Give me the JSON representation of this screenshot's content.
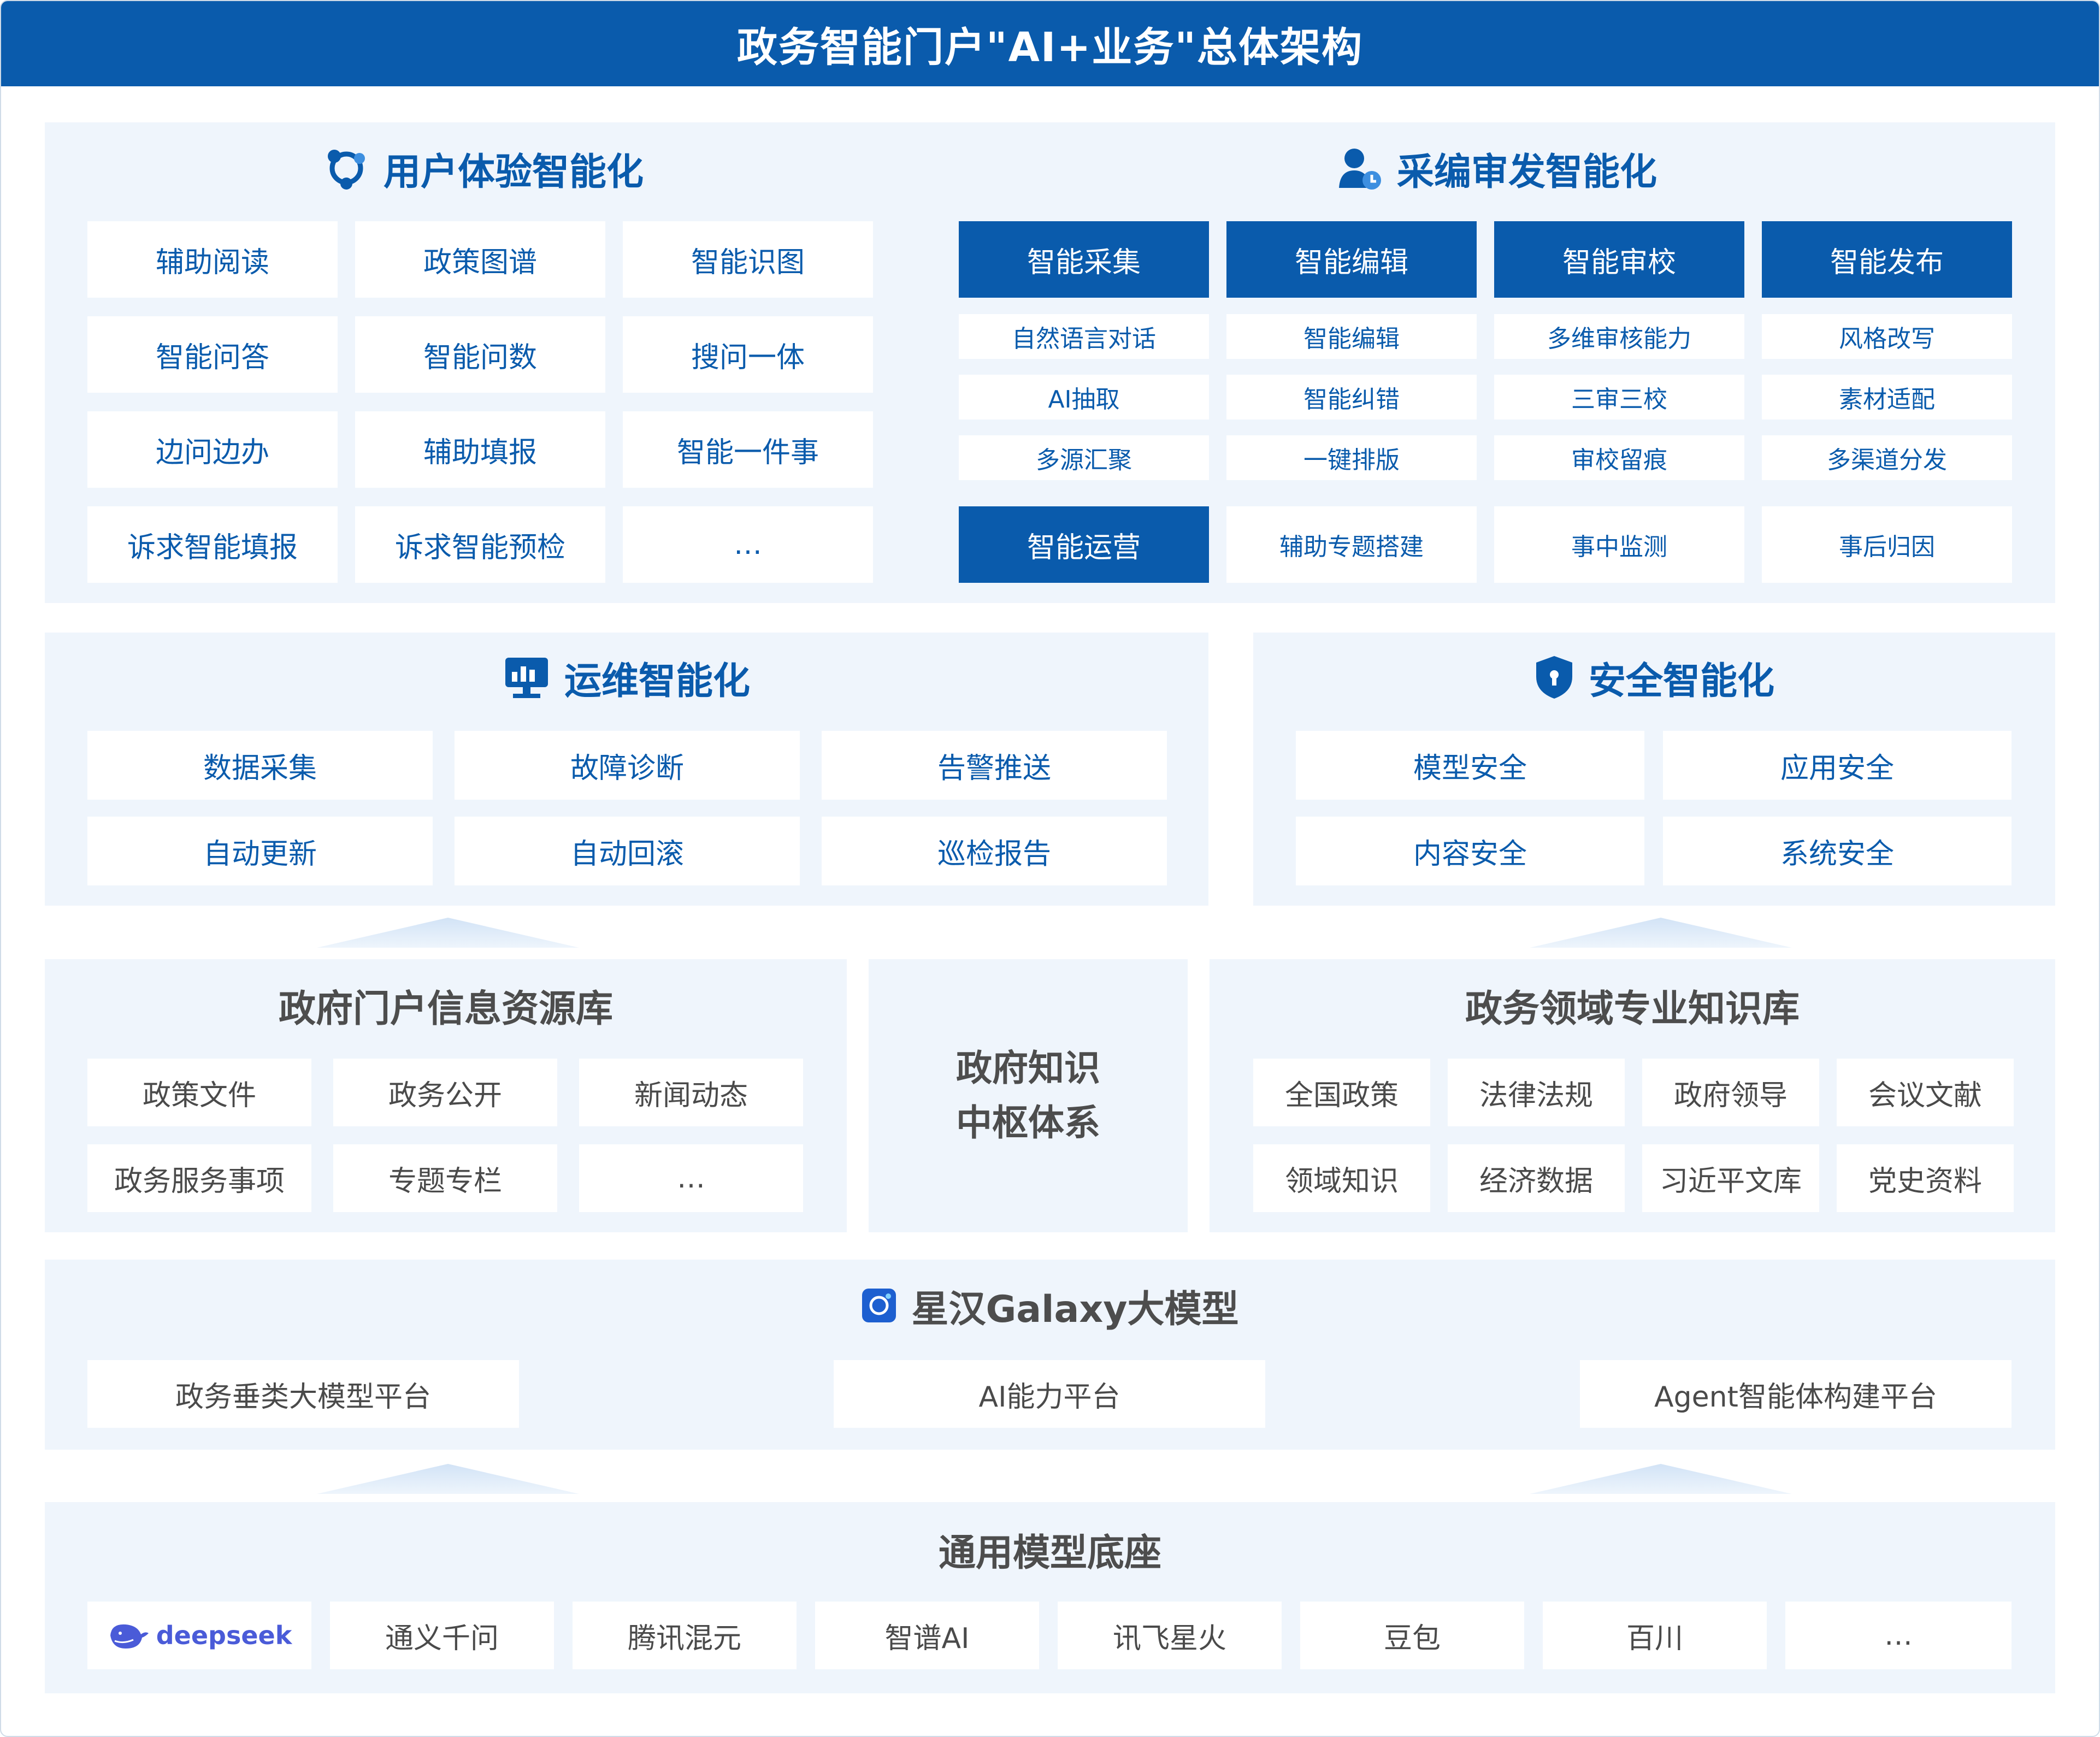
{
  "header": {
    "title": "政务智能门户\"AI+业务\"总体架构"
  },
  "user_experience": {
    "title": "用户体验智能化",
    "items": [
      "辅助阅读",
      "政策图谱",
      "智能识图",
      "智能问答",
      "智能问数",
      "搜问一体",
      "边问边办",
      "辅助填报",
      "智能一件事",
      "诉求智能填报",
      "诉求智能预检",
      "…"
    ]
  },
  "editing": {
    "title": "采编审发智能化",
    "columns": [
      {
        "head": "智能采集",
        "items": [
          "自然语言对话",
          "AI抽取",
          "多源汇聚"
        ]
      },
      {
        "head": "智能编辑",
        "items": [
          "智能编辑",
          "智能纠错",
          "一键排版"
        ]
      },
      {
        "head": "智能审校",
        "items": [
          "多维审核能力",
          "三审三校",
          "审校留痕"
        ]
      },
      {
        "head": "智能发布",
        "items": [
          "风格改写",
          "素材适配",
          "多渠道分发"
        ]
      }
    ],
    "operation": {
      "head": "智能运营",
      "items": [
        "辅助专题搭建",
        "事中监测",
        "事后归因"
      ]
    }
  },
  "ops": {
    "title": "运维智能化",
    "items": [
      "数据采集",
      "故障诊断",
      "告警推送",
      "自动更新",
      "自动回滚",
      "巡检报告"
    ]
  },
  "security": {
    "title": "安全智能化",
    "items": [
      "模型安全",
      "应用安全",
      "内容安全",
      "系统安全"
    ]
  },
  "portal_library": {
    "title": "政府门户信息资源库",
    "items": [
      "政策文件",
      "政务公开",
      "新闻动态",
      "政务服务事项",
      "专题专栏",
      "…"
    ]
  },
  "hub": {
    "line1": "政府知识",
    "line2": "中枢体系"
  },
  "domain_library": {
    "title": "政务领域专业知识库",
    "items": [
      "全国政策",
      "法律法规",
      "政府领导",
      "会议文献",
      "领域知识",
      "经济数据",
      "习近平文库",
      "党史资料"
    ]
  },
  "galaxy": {
    "title": "星汉Galaxy大模型",
    "platforms": [
      "政务垂类大模型平台",
      "AI能力平台",
      "Agent智能体构建平台"
    ]
  },
  "base": {
    "title": "通用模型底座",
    "deepseek_logo_text": "deepseek",
    "models": [
      "通义千问",
      "腾讯混元",
      "智谱AI",
      "讯飞星火",
      "豆包",
      "百川",
      "…"
    ]
  },
  "colors": {
    "primary": "#0a5bac",
    "panel": "#eff5fc",
    "text_gray": "#4a4a4a",
    "deepseek": "#4a5bd8"
  }
}
